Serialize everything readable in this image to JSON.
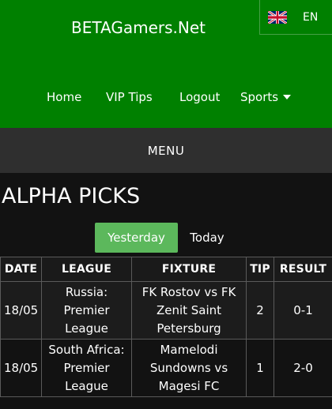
{
  "header": {
    "site_title": "BETAGamers.Net",
    "language": {
      "code": "EN",
      "flag_icon": "uk-flag-icon"
    },
    "nav": [
      {
        "label": "Home"
      },
      {
        "label": "VIP Tips"
      },
      {
        "label": "Logout"
      },
      {
        "label": "Sports",
        "icon": "caret-down-icon"
      }
    ],
    "background_color": "#008000"
  },
  "menu": {
    "label": "MENU"
  },
  "section": {
    "title": "ALPHA PICKS"
  },
  "tabs": [
    {
      "label": "Yesterday",
      "active": true,
      "color": "#5cb85c"
    },
    {
      "label": "Today",
      "active": false
    }
  ],
  "table": {
    "columns": [
      "DATE",
      "LEAGUE",
      "FIXTURE",
      "TIP",
      "RESULT"
    ],
    "rows": [
      {
        "date": "18/05",
        "league": "Russia: Premier League",
        "fixture": "FK Rostov vs FK Zenit Saint Petersburg",
        "tip": "2",
        "result": "0-1"
      },
      {
        "date": "18/05",
        "league": "South Africa: Premier League",
        "fixture": "Mamelodi Sundowns vs Magesi FC",
        "tip": "1",
        "result": "2-0"
      }
    ]
  }
}
